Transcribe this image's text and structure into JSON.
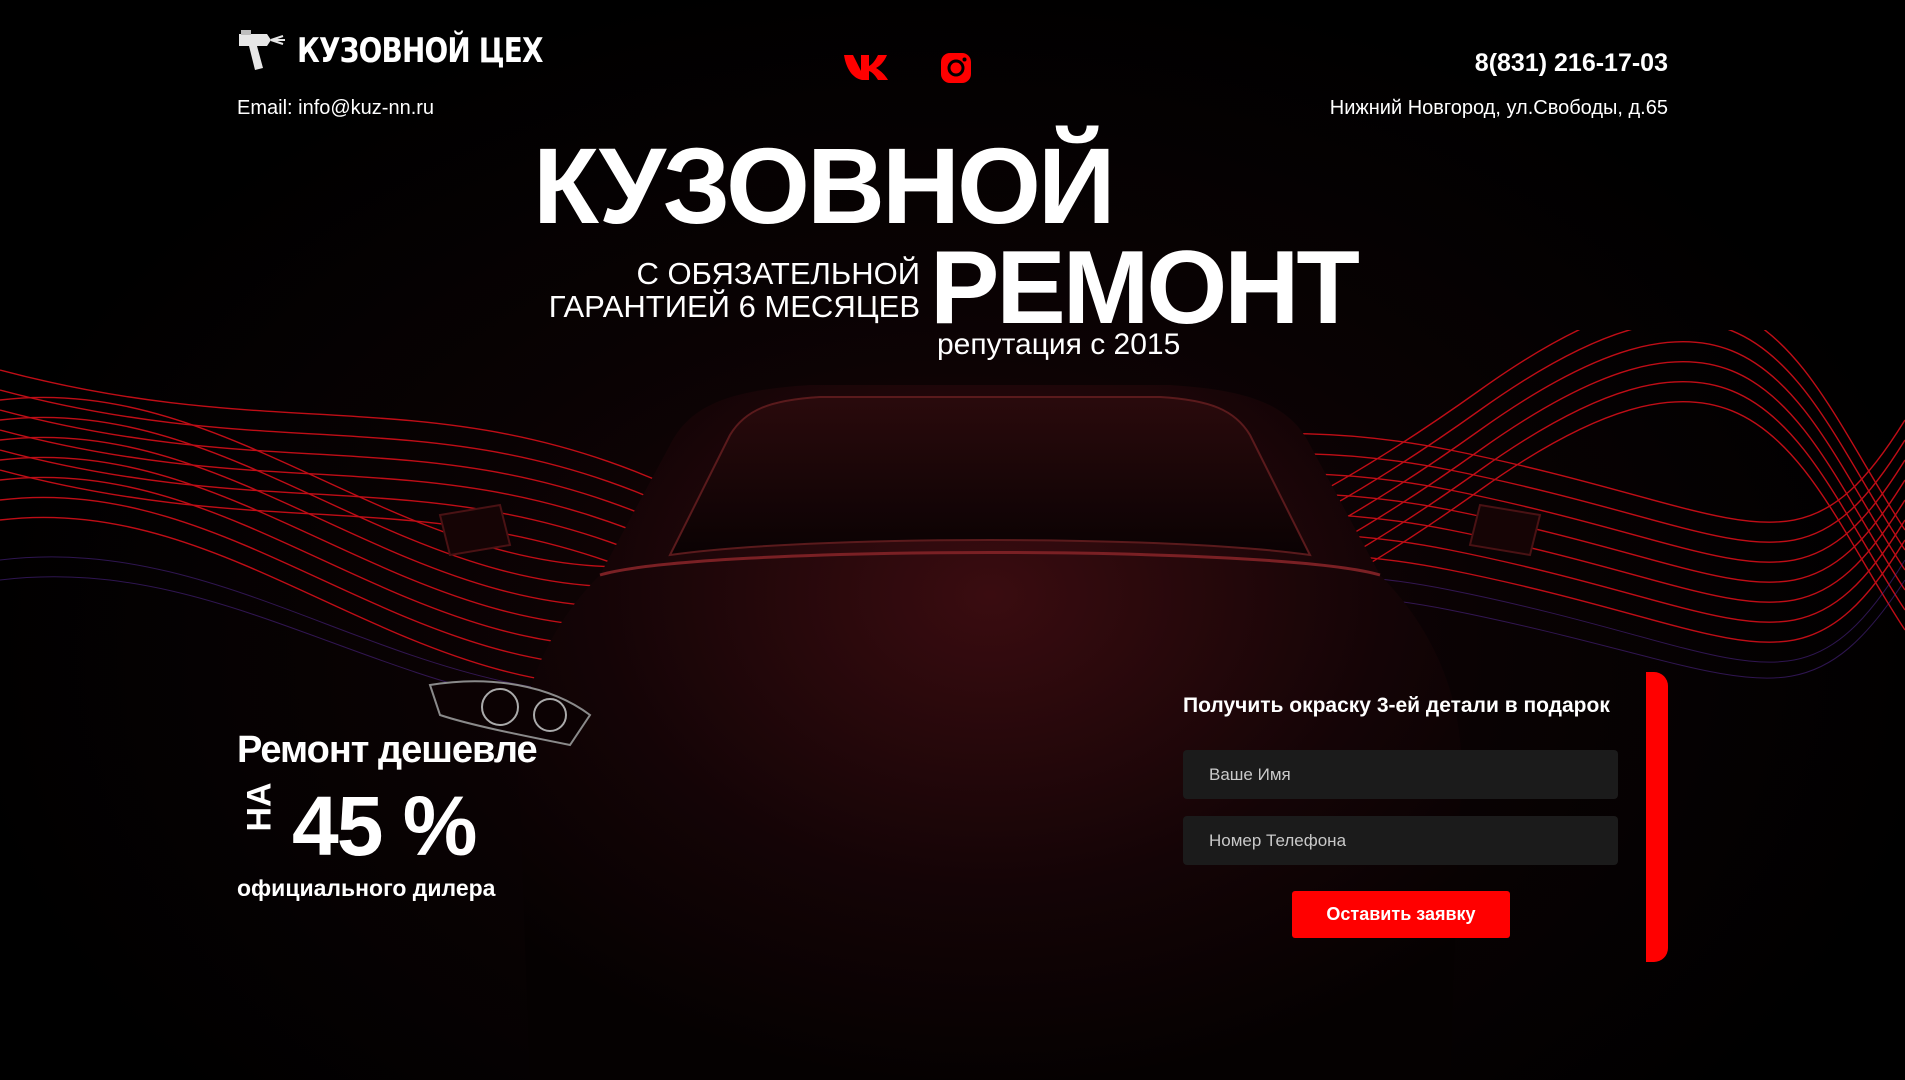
{
  "header": {
    "logo_text": "КУЗОВНОЙ ЦЕХ",
    "email": "Email: info@kuz-nn.ru",
    "phone": "8(831) 216-17-03",
    "address": "Нижний Новгород, ул.Свободы, д.65",
    "social": [
      {
        "name": "vk-icon",
        "color": "#ff0000"
      },
      {
        "name": "instagram-icon",
        "color": "#ff0000"
      }
    ]
  },
  "hero": {
    "title_line1": "КУЗОВНОЙ",
    "title_line2": "РЕМОНТ",
    "subtitle_line1": "С ОБЯЗАТЕЛЬНОЙ",
    "subtitle_line2": "ГАРАНТИЕЙ 6 МЕСЯЦЕВ",
    "reputation": "репутация с 2015"
  },
  "discount": {
    "title": "Ремонт дешевле",
    "prefix": "НА",
    "value": "45 %",
    "note": "официального дилера"
  },
  "form": {
    "title": "Получить окраску 3-ей детали в подарок",
    "name_placeholder": "Ваше Имя",
    "phone_placeholder": "Номер Телефона",
    "submit_label": "Оставить заявку"
  },
  "colors": {
    "accent": "#ff0000",
    "background": "#000000",
    "field_bg": "#1b1b1b"
  }
}
